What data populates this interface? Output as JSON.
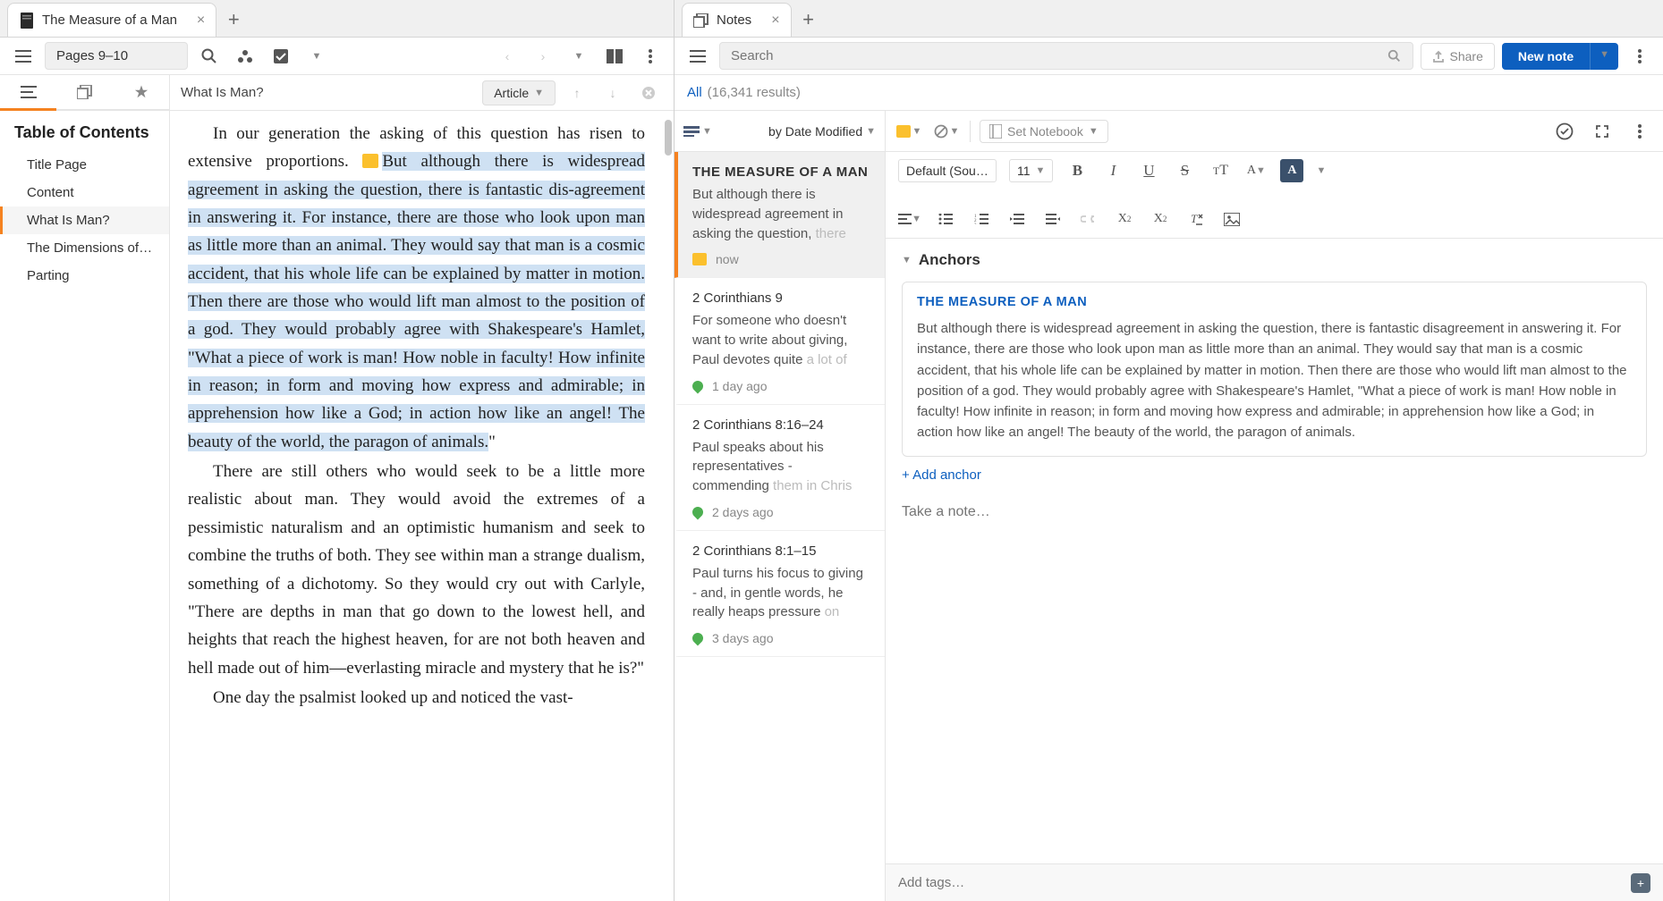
{
  "left": {
    "tab_title": "The Measure of a Man",
    "page_indicator": "Pages 9–10",
    "reader_heading": "What Is Man?",
    "article_label": "Article",
    "toc_title": "Table of Contents",
    "toc_items": [
      {
        "label": "Title Page"
      },
      {
        "label": "Content"
      },
      {
        "label": "What Is Man?"
      },
      {
        "label": "The Dimensions of a…"
      },
      {
        "label": "Parting"
      }
    ],
    "para1_a": "In our generation the asking of this question has risen to extensive proportions. ",
    "para1_hilite": "But although there is widespread agreement in asking the question, there is fantastic dis-agreement in answering it. For instance, there are those who look upon man as little more than an animal. They would say that man is a cosmic accident, that his whole life can be explained by matter in motion. Then there are those who would lift man almost to the position of a god. They would probably agree with Shakespeare's Hamlet, \"What a piece of work is man! How noble in faculty! How infinite in reason; in form and moving how express and admirable; in apprehension how like a God; in action how like an angel! The beauty of the world, the paragon of animals.",
    "para1_b": "\"",
    "para2": "There are still others who would seek to be a little more realistic about man. They would avoid the extremes of a pessimistic naturalism and an optimistic humanism and seek to combine the truths of both. They see within man a strange dualism, something of a dichotomy. So they would cry out with Carlyle, \"There are depths in man that go down to the lowest hell, and heights that reach the highest heaven, for are not both heaven and hell made out of him—everlasting miracle and mystery that he is?\"",
    "para3": "One day the psalmist looked up and noticed the vast-"
  },
  "right": {
    "tab_title": "Notes",
    "search_placeholder": "Search",
    "share_label": "Share",
    "new_note_label": "New note",
    "filter_all": "All",
    "filter_count": "(16,341 results)",
    "sort_label": "by Date Modified",
    "set_notebook": "Set Notebook",
    "font_default": "Default (Sou…",
    "font_size": "11",
    "anchors_label": "Anchors",
    "add_anchor": "+ Add anchor",
    "note_placeholder": "Take a note…",
    "tags_placeholder": "Add tags…",
    "anchor_card_title": "THE MEASURE OF A MAN",
    "anchor_card_text": "But although there is widespread agreement in asking the question, there is fantastic disagreement in answering it. For instance, there are those who look upon man as little more than an animal. They would say that man is a cosmic accident, that his whole life can be explained by matter in motion. Then there are those who would lift man almost to the position of a god. They would probably agree with Shakespeare's Hamlet, \"What a piece of work is man! How noble in faculty! How infinite in reason; in form and moving how express and admirable; in apprehension how like a God; in action how like an angel! The beauty of the world, the paragon of animals.",
    "notes": [
      {
        "ref": "THE MEASURE OF A MAN",
        "preview_dark": "But although there is widespread agreement in asking the question, ",
        "preview_fade": "there",
        "time": "now",
        "icon": "yellow",
        "uppercase": true
      },
      {
        "ref": "2 Corinthians 9",
        "preview_dark": "For someone who doesn't want to write about giving, Paul devotes quite ",
        "preview_fade": "a lot of",
        "time": "1 day ago",
        "icon": "green"
      },
      {
        "ref": "2 Corinthians 8:16–24",
        "preview_dark": "Paul speaks about his representatives - commending ",
        "preview_fade": "them in Chris",
        "time": "2 days ago",
        "icon": "green"
      },
      {
        "ref": "2 Corinthians 8:1–15",
        "preview_dark": "Paul turns his focus to giving - and, in gentle words, he really heaps pressure ",
        "preview_fade": "on",
        "time": "3 days ago",
        "icon": "green"
      }
    ]
  }
}
